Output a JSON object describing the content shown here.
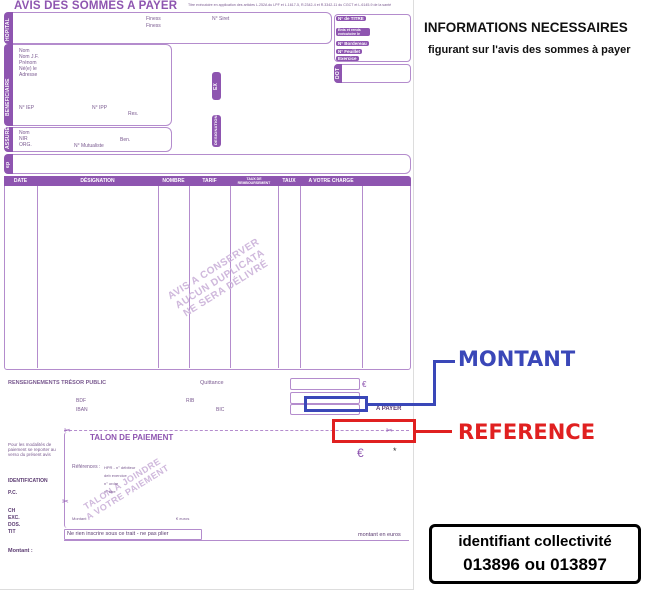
{
  "form": {
    "title": "AVIS DES SOMMES A PAYER",
    "legal_note": "Titre exécutoire en application des articles L.252A du LPF et L.1617-5, R.2342-4 et R.3342-11 du CGCT et L.6145-9 de la santé",
    "side_labels": {
      "hopital": "HOPITAL",
      "beneficiaire": "BENEFICIAIRE",
      "assure": "ASSURE",
      "ex": "EX",
      "ep": "ep",
      "designation": "DESIGNATION",
      "dot": "DOT"
    },
    "hopital_fields": {
      "finess1": "Finess",
      "finess2": "Finess",
      "siret": "N° Siret"
    },
    "right_tags": {
      "titre": "N° de TITRE",
      "ents": "Ents et rends exécutoire le",
      "bordereau": "N° Bordereau",
      "feuillet": "N° Feuillet",
      "exercice": "Exercice"
    },
    "beneficiaire_fields": {
      "nom": "Nom",
      "nom_jf": "Nom J.F.",
      "prenom": "Prénom",
      "ne_le": "Né(e) le",
      "adresse": "Adresse",
      "iep": "N° IEP",
      "ipp": "N° IPP",
      "res": "Res."
    },
    "assure_fields": {
      "nom": "Nom",
      "nir": "NIR",
      "org": "ORG.",
      "ben": "Ben.",
      "mutualiste": "N° Mutualiste"
    },
    "table_headers": [
      "DATE",
      "DÉSIGNATION",
      "NOMBRE",
      "TARIF",
      "TAUX DE REMBOURSEMENT",
      "TAUX",
      "A VOTRE CHARGE"
    ],
    "watermark": "AVIS A CONSERVER\nAUCUN DUPLICATA\nNE SERA DÉLIVRÉ",
    "tresor_label": "RENSEIGNEMENTS TRÉSOR PUBLIC",
    "quittance": "Quittance",
    "bdf": "BDF",
    "rib": "RIB",
    "iban": "IBAN",
    "bic": "BIC",
    "a_payer": "A PAYER",
    "euro": "€",
    "talon_title": "TALON DE PAIEMENT",
    "talon_watermark": "TALON A JOINDRE\nA VOTRE PAIEMENT",
    "talon_side_note": "Pour les modalités de paiement se reporter au verso du présent avis",
    "identification": "IDENTIFICATION",
    "codes": [
      "P.C.",
      "CH",
      "EXC.",
      "DOS.",
      "TIT"
    ],
    "references_label": "Références :",
    "ref_lines": [
      "HPR - n° débiteur",
      "deb      exercice",
      "n° ordre",
      "n° titre"
    ],
    "montant_small": "Montant",
    "euros_small": "€ euros",
    "ne_rien_inscrire": "Ne rien inscrire sous ce trait - ne pas plier",
    "montant_en_euros": "montant en euros",
    "montant_label": "Montant :",
    "star": "*"
  },
  "annotations": {
    "heading": "INFORMATIONS NECESSAIRES",
    "subheading": "figurant sur l'avis des sommes à payer",
    "montant": "MONTANT",
    "reference": "REFERENCE",
    "collectivite_label": "identifiant collectivité",
    "collectivite_value": "013896 ou 013897",
    "colors": {
      "blue": "#3a47b8",
      "red": "#e02020",
      "purple": "#8e55b0"
    }
  }
}
